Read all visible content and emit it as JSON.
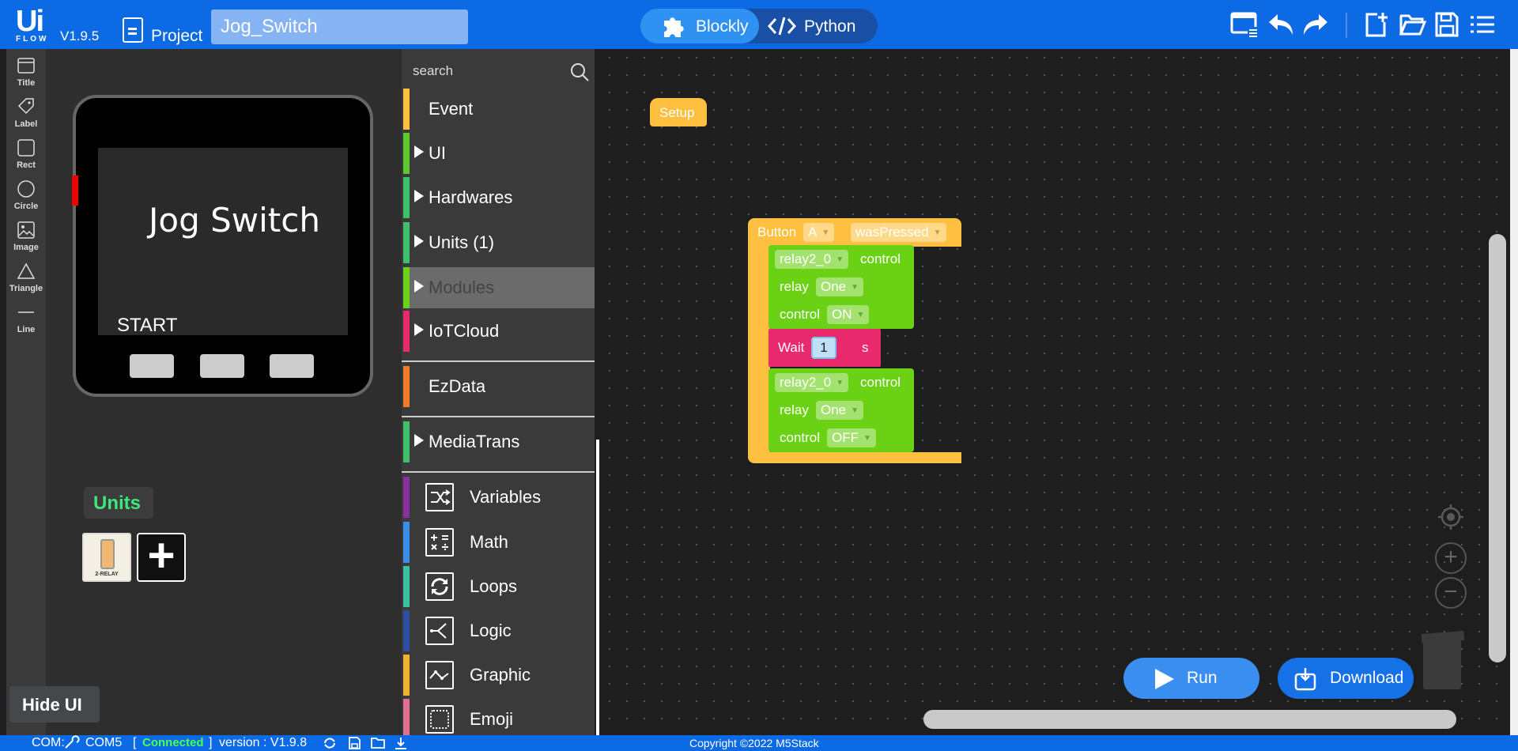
{
  "header": {
    "logo_top": "Ui",
    "logo_bottom": "FLOW",
    "version": "V1.9.5",
    "project_label": "Project",
    "project_name": "Jog_Switch",
    "modes": {
      "blockly": "Blockly",
      "python": "Python",
      "active": "Blockly"
    },
    "toolbar_icons": [
      "device-settings-icon",
      "undo-icon",
      "redo-icon",
      "new-file-icon",
      "open-folder-icon",
      "save-icon",
      "menu-list-icon"
    ]
  },
  "tools": [
    {
      "label": "Title",
      "icon": "title-icon"
    },
    {
      "label": "Label",
      "icon": "label-tag-icon"
    },
    {
      "label": "Rect",
      "icon": "rect-icon"
    },
    {
      "label": "Circle",
      "icon": "circle-icon"
    },
    {
      "label": "Image",
      "icon": "image-icon"
    },
    {
      "label": "Triangle",
      "icon": "triangle-icon"
    },
    {
      "label": "Line",
      "icon": "line-icon"
    }
  ],
  "device": {
    "screen_title": "Jog Switch",
    "screen_label": "START"
  },
  "units": {
    "label": "Units",
    "items": [
      {
        "name": "2-RELAY"
      }
    ],
    "add": "+"
  },
  "hide_ui": "Hide UI",
  "categories": {
    "search_placeholder": "search",
    "items": [
      {
        "label": "Event",
        "color": "#ffbf40",
        "expandable": false
      },
      {
        "label": "UI",
        "color": "#5bc92e",
        "expandable": true
      },
      {
        "label": "Hardwares",
        "color": "#3fbf6a",
        "expandable": true
      },
      {
        "label": "Units (1)",
        "color": "#3fbf6a",
        "expandable": true
      },
      {
        "label": "Modules",
        "color": "#6bd11a",
        "expandable": true,
        "selected": true
      },
      {
        "label": "IoTCloud",
        "color": "#e8296b",
        "expandable": true
      },
      {
        "label": "EzData",
        "color": "#f07b2a",
        "expandable": false
      },
      {
        "label": "MediaTrans",
        "color": "#3fbf6a",
        "expandable": true
      },
      {
        "label": "Variables",
        "color": "#8a2fa0",
        "icon": "variables-icon"
      },
      {
        "label": "Math",
        "color": "#3a8ee6",
        "icon": "math-icon"
      },
      {
        "label": "Loops",
        "color": "#3fbfa0",
        "icon": "loops-icon"
      },
      {
        "label": "Logic",
        "color": "#2d4fa0",
        "icon": "logic-icon"
      },
      {
        "label": "Graphic",
        "color": "#f0b030",
        "icon": "graphic-icon"
      },
      {
        "label": "Emoji",
        "color": "#e07090",
        "icon": "emoji-icon"
      }
    ]
  },
  "blocks": {
    "setup": "Setup",
    "event": {
      "label": "Button",
      "button": "A",
      "action": "wasPressed"
    },
    "relay_block_1": {
      "unit": "relay2_0",
      "control_label": "control",
      "relay_label": "relay",
      "relay": "One",
      "control_field": "control",
      "state": "ON"
    },
    "wait": {
      "label": "Wait",
      "value": "1",
      "unit": "s"
    },
    "relay_block_2": {
      "unit": "relay2_0",
      "control_label": "control",
      "relay_label": "relay",
      "relay": "One",
      "control_field": "control",
      "state": "OFF"
    }
  },
  "actions": {
    "run": "Run",
    "download": "Download"
  },
  "status": {
    "com_label": "COM:",
    "com_port": "COM5",
    "bracket_open": "[",
    "connection": "Connected",
    "bracket_close": "]",
    "version": "version : V1.9.8",
    "copyright": "Copyright ©2022 M5Stack"
  },
  "colors": {
    "header": "#0d6ae5",
    "workspace": "#1e1e1e",
    "event_block": "#ffbf40",
    "relay_block": "#6ad114",
    "wait_block": "#e8296b",
    "connected": "#4cff4c"
  }
}
